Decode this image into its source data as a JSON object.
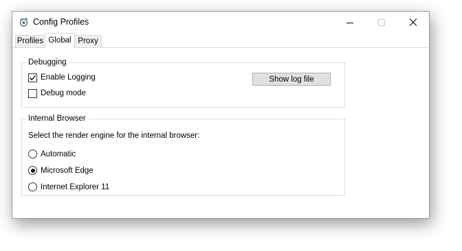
{
  "window": {
    "title": "Config Profiles"
  },
  "titlebar_buttons": {
    "minimize_icon": "minimize-icon",
    "maximize_icon": "maximize-icon",
    "close_icon": "close-icon"
  },
  "tabs": [
    {
      "label": "Profiles",
      "selected": false
    },
    {
      "label": "Global",
      "selected": true
    },
    {
      "label": "Proxy",
      "selected": false
    }
  ],
  "debugging": {
    "legend": "Debugging",
    "enable_logging": {
      "label": "Enable Logging",
      "checked": true
    },
    "debug_mode": {
      "label": "Debug mode",
      "checked": false
    },
    "show_log_button": "Show log file"
  },
  "internal_browser": {
    "legend": "Internal Browser",
    "prompt": "Select the render engine for the internal browser:",
    "options": [
      {
        "label": "Automatic",
        "selected": false
      },
      {
        "label": "Microsoft Edge",
        "selected": true
      },
      {
        "label": "Internet Explorer 11",
        "selected": false
      }
    ]
  },
  "colors": {
    "button_face": "#e1e1e1",
    "tab_inactive": "#f0f0f0",
    "border": "#dcdcdc"
  }
}
